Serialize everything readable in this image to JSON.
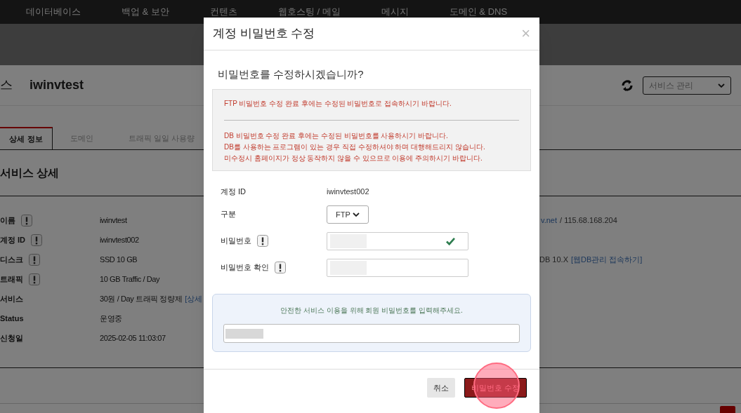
{
  "nav": {
    "items": [
      "데이터베이스",
      "백업 & 보안",
      "컨텐츠",
      "웹호스팅 / 메일",
      "메시지",
      "도메인 & DNS"
    ]
  },
  "page": {
    "title_prefix": "스",
    "title": "iwinvtest",
    "service_menu": "서비스 관리",
    "tabs": [
      {
        "label": "상세 정보",
        "selected": true
      },
      {
        "label": "도메인",
        "selected": false
      },
      {
        "label": "트래픽 일일 사용량",
        "selected": false
      }
    ],
    "section_title": "서비스 상세",
    "rows": [
      {
        "label": "이름",
        "info": true,
        "value": "iwinvtest"
      },
      {
        "label": "계정 ID",
        "info": true,
        "value": "iwinvtest002"
      },
      {
        "label": "디스크",
        "info": true,
        "value": "SSD 10 GB"
      },
      {
        "label": "트래픽",
        "info": true,
        "value": "10 GB Traffic / Day"
      },
      {
        "label": "서비스",
        "info": false,
        "value": "30원 / Day 트래픽 정량제",
        "link": "[상세"
      },
      {
        "label": "Status",
        "info": false,
        "value": "운영중"
      },
      {
        "label": "신청일",
        "info": false,
        "value": "2025-02-05 11:03:07"
      }
    ],
    "right_rows": [
      {
        "link": "v.net",
        "value": "/ 115.68.168.204"
      },
      {
        "value": "DB 10.X",
        "link": "[웹DB관리 접속하기]"
      }
    ]
  },
  "dialog": {
    "title": "계정 비밀번호 수정",
    "close": "×",
    "question": "비밀번호를 수정하시겠습니까?",
    "notices": [
      [
        "FTP 비밀번호 수정 완료 후에는 수정된 비밀번호로 접속하시기 바랍니다."
      ],
      [
        "DB 비밀번호 수정 완료 후에는 수정된 비밀번호를 사용하시기 바랍니다.",
        "DB를 사용하는 프로그램이 있는 경우 직접 수정하셔야 하며 대행해드리지 않습니다.",
        "미수정시 홈페이지가 정상 동작하지 않을 수 있으므로 이용에 주의하시기 바랍니다."
      ]
    ],
    "fields": [
      {
        "kind": "text",
        "label": "계정 ID",
        "info": false,
        "value": "iwinvtest002"
      },
      {
        "kind": "select",
        "label": "구분",
        "info": false,
        "value": "FTP"
      },
      {
        "kind": "password",
        "label": "비밀번호",
        "info": true,
        "valid": true
      },
      {
        "kind": "password",
        "label": "비밀번호 확인",
        "info": true,
        "valid": false
      }
    ],
    "verify_text": "안전한 서비스 이용을 위해 회원 비밀번호를 입력해주세요.",
    "buttons": [
      {
        "kind": "secondary",
        "label": "취소"
      },
      {
        "kind": "primary",
        "label": "비밀번호 수정"
      }
    ]
  }
}
